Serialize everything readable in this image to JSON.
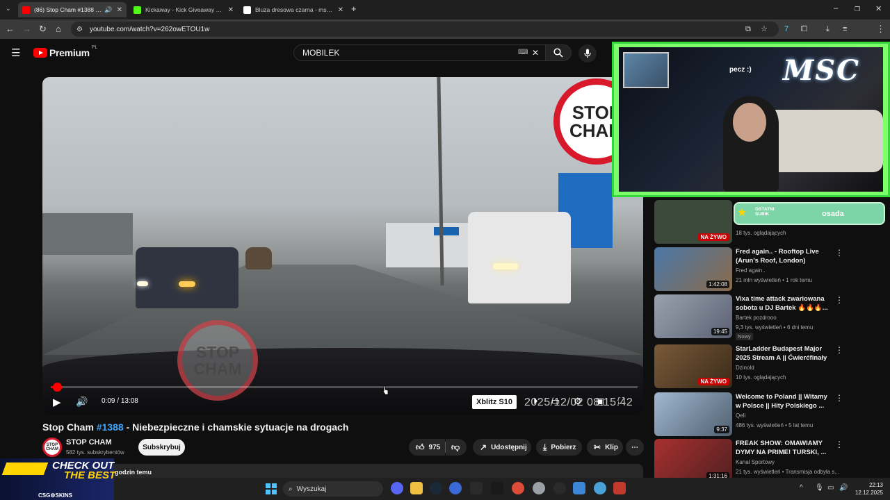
{
  "browser": {
    "tabs": [
      {
        "title": "(86) Stop Cham #1388 - Nie",
        "active": true,
        "favicon_color": "#ff0000"
      },
      {
        "title": "Kickaway - Kick Giveaway Tool",
        "active": false,
        "favicon_color": "#53fc18"
      },
      {
        "title": "Bluza dresowa czarna - msc_d",
        "active": false,
        "favicon_color": "#ffffff"
      }
    ],
    "url": "youtube.com/watch?v=262owETOU1w"
  },
  "youtube": {
    "logo_text": "Premium",
    "region": "PL",
    "search_value": "MOBILEK"
  },
  "player": {
    "current_time": "0:09",
    "duration": "13:08",
    "progress": 0.011,
    "stop_sign": [
      "STOP",
      "CHAM"
    ],
    "watermark": [
      "STOP",
      "CHAM"
    ],
    "sponsor": "Xblitz S10",
    "dashcam_timestamp": "2025/12/02 08:15:42"
  },
  "video": {
    "title_prefix": "Stop Cham ",
    "title_tag": "#1388",
    "title_rest": " - Niebezpieczne i chamskie sytuacje na drogach",
    "channel_avatar_text": "STOP CHAM",
    "channel": "STOP CHAM",
    "subscribers": "582 tys. subskrybentów",
    "subscribe_label": "Subskrybuj",
    "likes": "975",
    "share_label": "Udostępnij",
    "download_label": "Pobierz",
    "clip_label": "Klip",
    "description_snippet": "godzin temu"
  },
  "recommendations": [
    {
      "title": "",
      "channel": "",
      "meta": "18 tys. oglądających",
      "live_label": "NA ŻYWO",
      "duration": "",
      "badge": "",
      "thumb": "#3c4a3c"
    },
    {
      "title": "Fred again.. - Rooftop Live (Arun's Roof, London)",
      "channel": "Fred again..",
      "meta": "21 mln wyświetleń • 1 rok temu",
      "live_label": "",
      "duration": "1:42:08",
      "badge": "",
      "thumb": "#8a6a4a"
    },
    {
      "title": "Vixa time attack zwariowana sobota u DJ Bartek 🔥🔥🔥...",
      "channel": "Bartek pozdrooo",
      "meta": "9,3 tys. wyświetleń • 6 dni temu",
      "live_label": "",
      "duration": "19:45",
      "badge": "Nowy",
      "thumb": "#6a7080"
    },
    {
      "title": "StarLadder Budapest Major 2025 Stream A || Ćwierćfinały |...",
      "channel": "Dzinold",
      "meta": "10 tys. oglądających",
      "live_label": "NA ŻYWO",
      "duration": "",
      "badge": "",
      "thumb": "#5a4a38"
    },
    {
      "title": "Welcome to Poland || Witamy w Polsce || Hity Polskiego ...",
      "channel": "Qeli",
      "meta": "486 tys. wyświetleń • 5 lat temu",
      "live_label": "",
      "duration": "9:37",
      "badge": "",
      "thumb": "#7088a0"
    },
    {
      "title": "FREAK SHOW: OMAWIAMY DYMY NA PRIME! TURSKI, ...",
      "channel": "Kanał Sportowy",
      "meta": "21 tys. wyświetleń • Transmisja odbyła s...",
      "live_label": "",
      "duration": "1:31:16",
      "badge": "",
      "thumb": "#8a2a2a"
    }
  ],
  "stream_overlay": {
    "streamer_text": "pecz :)",
    "logo": "MSC",
    "goal_label": "OSTATNI SUBIK",
    "goal_name": "osada"
  },
  "ad": {
    "headline_1": "CHECK OUT",
    "headline_2": "THE BEST",
    "brand": "CSG⚙SKINS"
  },
  "taskbar": {
    "search_placeholder": "Wyszukaj",
    "time": "22:13",
    "date": "12.12.2025"
  }
}
